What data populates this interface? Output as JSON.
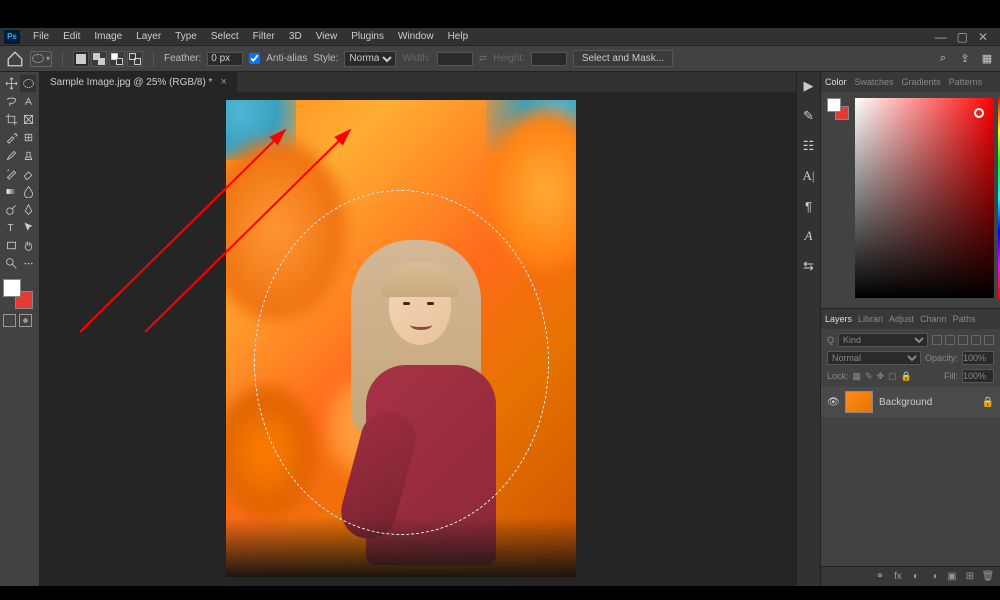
{
  "menu": [
    "File",
    "Edit",
    "Image",
    "Layer",
    "Type",
    "Select",
    "Filter",
    "3D",
    "View",
    "Plugins",
    "Window",
    "Help"
  ],
  "optbar": {
    "feather_label": "Feather:",
    "feather_value": "0 px",
    "antialias_label": "Anti-alias",
    "antialias_checked": true,
    "style_label": "Style:",
    "style_value": "Normal",
    "width_label": "Width:",
    "width_value": "",
    "height_label": "Height:",
    "height_value": "",
    "select_mask": "Select and Mask..."
  },
  "tab": {
    "title": "Sample Image.jpg @ 25% (RGB/8) *"
  },
  "color_tabs": [
    "Color",
    "Swatches",
    "Gradients",
    "Patterns"
  ],
  "layer_tabs": [
    "Layers",
    "Librari",
    "Adjust",
    "Chann",
    "Paths"
  ],
  "layers": {
    "kind_label": "Kind",
    "blend": "Normal",
    "opacity_label": "Opacity:",
    "opacity_value": "100%",
    "lock_label": "Lock:",
    "fill_label": "Fill:",
    "fill_value": "100%",
    "bg_layer": "Background"
  },
  "colors": {
    "fg": "#ffffff",
    "bg": "#e53935"
  }
}
